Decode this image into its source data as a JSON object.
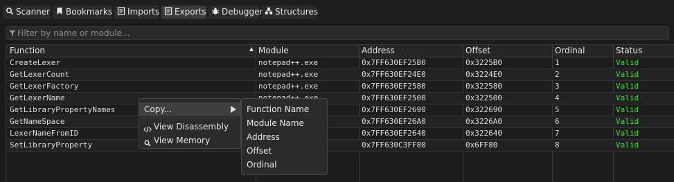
{
  "tabs": [
    {
      "label": "Scanner",
      "icon": "search-icon"
    },
    {
      "label": "Bookmarks",
      "icon": "bookmark-icon"
    },
    {
      "label": "Imports",
      "icon": "import-icon"
    },
    {
      "label": "Exports",
      "icon": "export-icon",
      "active": true
    },
    {
      "label": "Debugger",
      "icon": "bug-icon"
    },
    {
      "label": "Structures",
      "icon": "structures-icon"
    }
  ],
  "filter": {
    "placeholder": "Filter by name or module..."
  },
  "table": {
    "columns": [
      "Function",
      "Module",
      "Address",
      "Offset",
      "Ordinal",
      "Status"
    ],
    "sorted_column": "Function",
    "rows": [
      {
        "function": "CreateLexer",
        "module": "notepad++.exe",
        "address": "0x7FF630EF25B0",
        "offset": "0x3225B0",
        "ordinal": "1",
        "status": "Valid"
      },
      {
        "function": "GetLexerCount",
        "module": "notepad++.exe",
        "address": "0x7FF630EF24E0",
        "offset": "0x3224E0",
        "ordinal": "2",
        "status": "Valid"
      },
      {
        "function": "GetLexerFactory",
        "module": "notepad++.exe",
        "address": "0x7FF630EF2580",
        "offset": "0x322580",
        "ordinal": "3",
        "status": "Valid"
      },
      {
        "function": "GetLexerName",
        "module": "notepad++.exe",
        "address": "0x7FF630EF2500",
        "offset": "0x322500",
        "ordinal": "4",
        "status": "Valid"
      },
      {
        "function": "GetLibraryPropertyNames",
        "module": "",
        "address": "0x7FF630EF2690",
        "offset": "0x322690",
        "ordinal": "5",
        "status": "Valid"
      },
      {
        "function": "GetNameSpace",
        "module": "",
        "address": "0x7FF630EF26A0",
        "offset": "0x3226A0",
        "ordinal": "6",
        "status": "Valid"
      },
      {
        "function": "LexerNameFromID",
        "module": "",
        "address": "0x7FF630EF2640",
        "offset": "0x322640",
        "ordinal": "7",
        "status": "Valid"
      },
      {
        "function": "SetLibraryProperty",
        "module": "",
        "address": "0x7FF630C3FF80",
        "offset": "0x6FF80",
        "ordinal": "8",
        "status": "Valid"
      }
    ]
  },
  "context_menu": {
    "items": [
      {
        "label": "Copy...",
        "has_submenu": true
      },
      {
        "label": "View Disassembly",
        "icon": "code-icon"
      },
      {
        "label": "View Memory",
        "icon": "search-icon"
      }
    ],
    "submenu": [
      "Function Name",
      "Module Name",
      "Address",
      "Offset",
      "Ordinal"
    ]
  },
  "colors": {
    "status_valid": "#39e139",
    "background": "#1b1b1b",
    "header": "#262626"
  }
}
